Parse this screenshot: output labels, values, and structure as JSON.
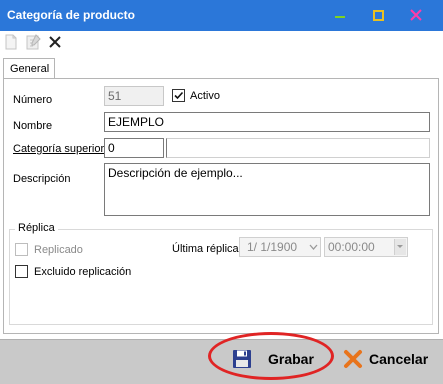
{
  "window": {
    "title": "Categoría de producto",
    "icons": [
      "minimize-icon",
      "maximize-icon",
      "close-icon"
    ]
  },
  "toolbar": {
    "icons": [
      "new-document-icon",
      "edit-document-icon",
      "delete-x-icon"
    ]
  },
  "tabs": [
    {
      "label": "General",
      "selected": true
    }
  ],
  "form": {
    "numero_label": "Número",
    "numero_value": "51",
    "activo_label": "Activo",
    "activo_checked": true,
    "nombre_label": "Nombre",
    "nombre_value": "EJEMPLO",
    "categoria_label": "Categoría superior",
    "categoria_value": "0",
    "descripcion_label": "Descripción",
    "descripcion_value": "Descripción de ejemplo..."
  },
  "replica": {
    "group_label": "Réplica",
    "replicado_label": "Replicado",
    "replicado_checked": false,
    "ultima_label": "Última réplica:",
    "date_value": "1/ 1/1900",
    "time_value": "00:00:00",
    "excluido_label": "Excluido replicación",
    "excluido_checked": false
  },
  "buttons": {
    "save_label": "Grabar",
    "cancel_label": "Cancelar"
  },
  "colors": {
    "titlebar": "#2b77d9",
    "bottombar": "#c9c9c9",
    "highlight": "#e02424",
    "cancel_x": "#e8741c"
  }
}
